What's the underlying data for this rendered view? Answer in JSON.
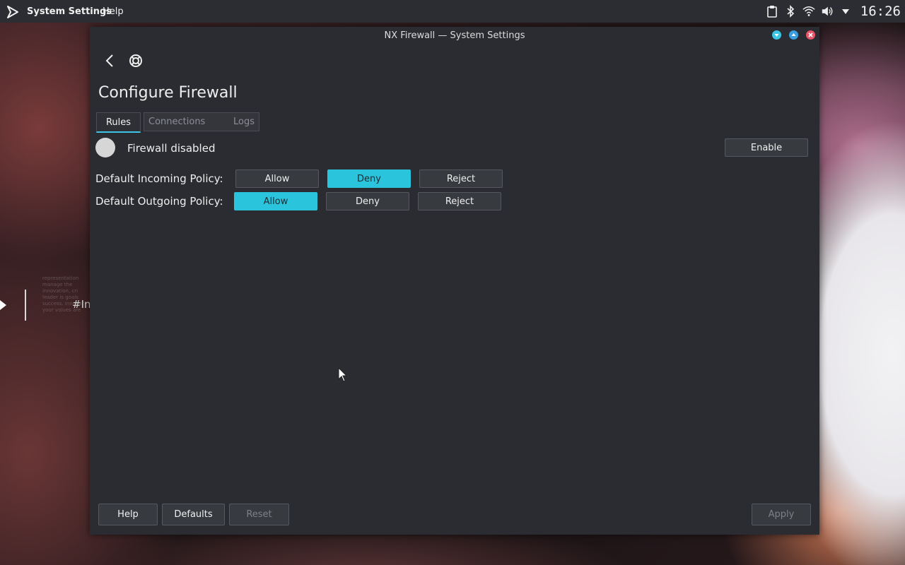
{
  "topbar": {
    "app_name": "System Settings",
    "help_menu": "Help",
    "clock": "16:26",
    "tray_icons": [
      "clipboard-icon",
      "bluetooth-icon",
      "wifi-icon",
      "volume-icon",
      "menu-arrow-icon"
    ]
  },
  "wallpaper": {
    "hashtag": "#In",
    "faded_text": "representation manage the innovation, cri leader is goals success. Innovat your values are"
  },
  "window": {
    "title": "NX Firewall — System Settings",
    "page_title": "Configure Firewall",
    "tabs": [
      "Rules",
      "Connections",
      "Logs"
    ],
    "status": {
      "label": "Firewall disabled",
      "enable_label": "Enable"
    },
    "incoming": {
      "label": "Default Incoming Policy:",
      "options": [
        "Allow",
        "Deny",
        "Reject"
      ],
      "selected": "Deny"
    },
    "outgoing": {
      "label": "Default Outgoing Policy:",
      "options": [
        "Allow",
        "Deny",
        "Reject"
      ],
      "selected": "Allow"
    },
    "footer": {
      "help": "Help",
      "defaults": "Defaults",
      "reset": "Reset",
      "apply": "Apply"
    }
  },
  "colors": {
    "accent": "#2ac4dc",
    "window_bg": "#2a2c31",
    "panel_bg": "#2b2d32",
    "close": "#ea5569"
  }
}
